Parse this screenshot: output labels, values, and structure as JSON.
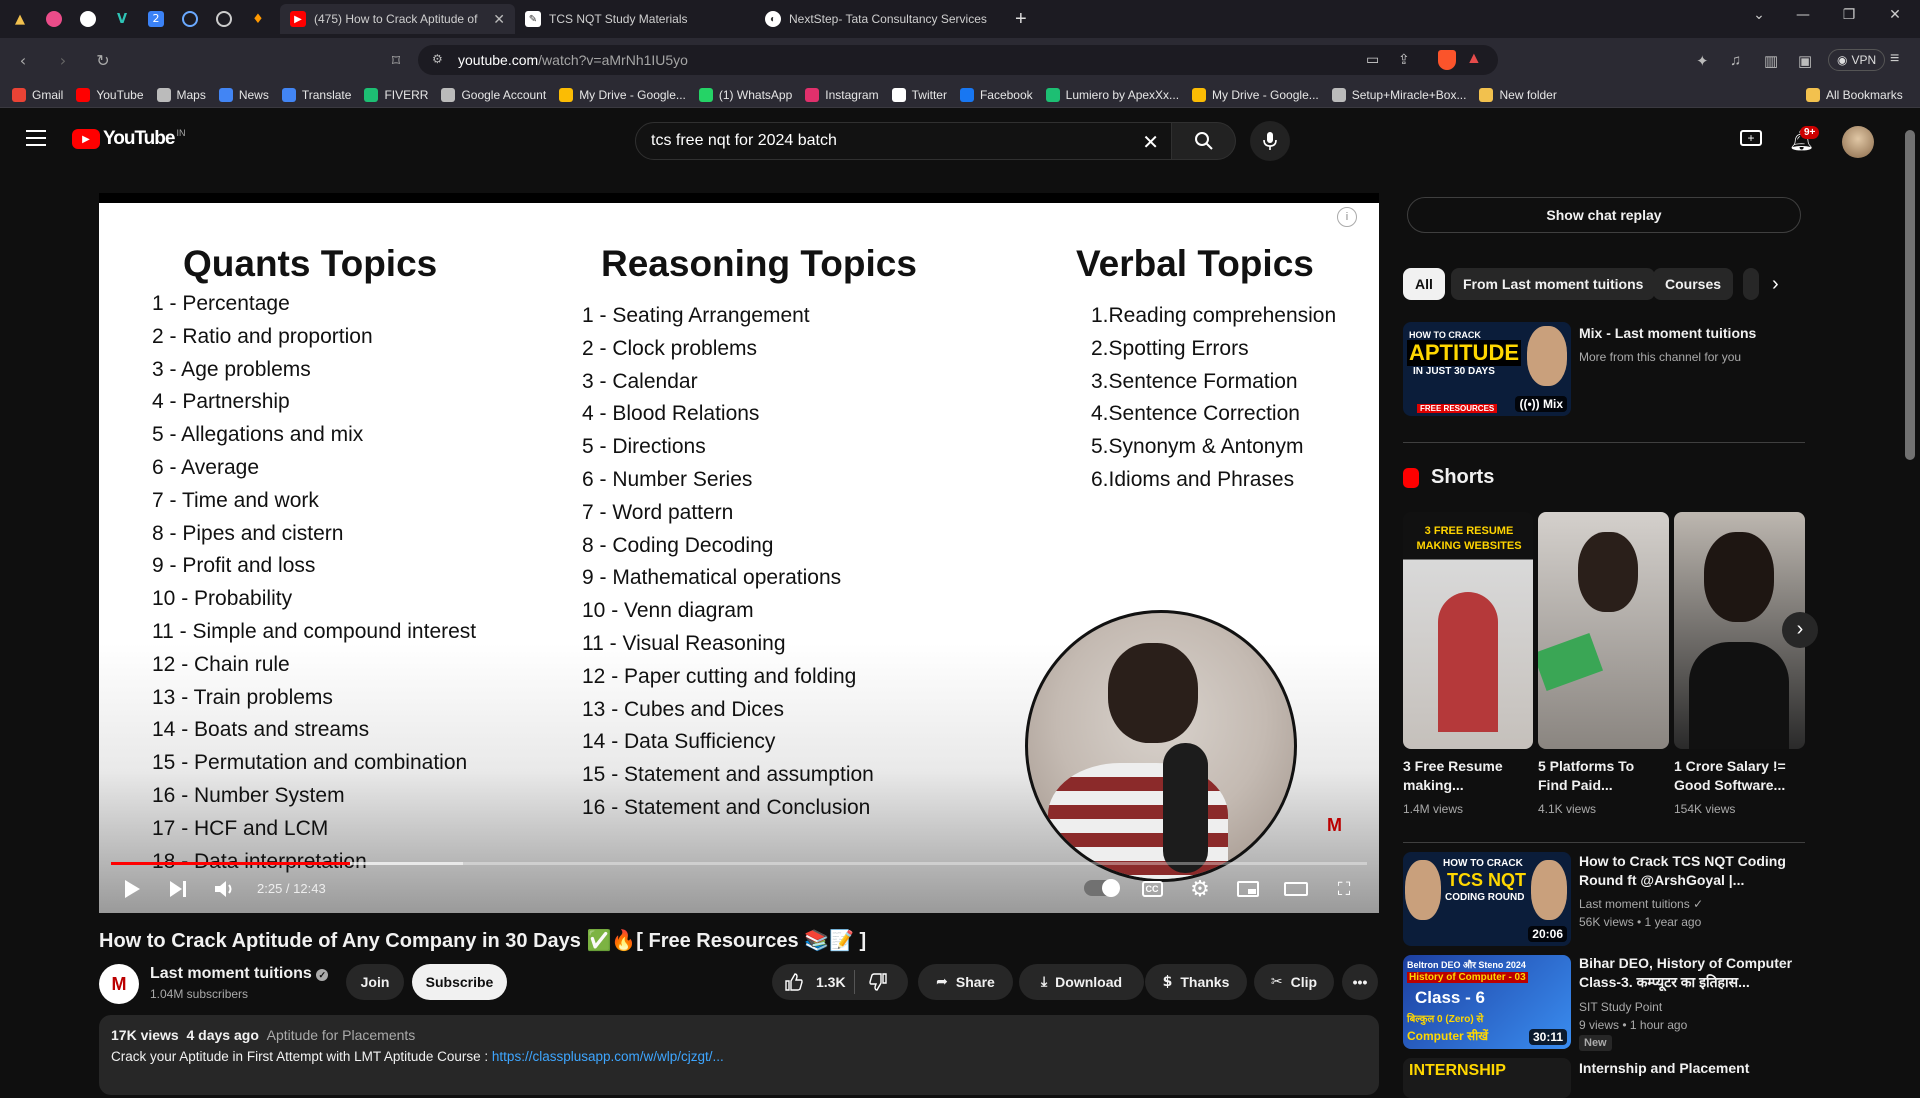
{
  "browser": {
    "tabs": [
      {
        "title": "(475) How to Crack Aptitude of",
        "active": true
      },
      {
        "title": "TCS NQT Study Materials",
        "active": false
      },
      {
        "title": "NextStep- Tata Consultancy Services",
        "active": false
      }
    ],
    "pinned_tab_icons": [
      "triangle-icon",
      "dribbble-icon",
      "github-icon",
      "vector-icon",
      "number-2-icon",
      "circle-logo-icon",
      "chrome-icon",
      "flame-icon"
    ],
    "new_tab": "+",
    "url_domain": "youtube.com",
    "url_path": "/watch?v=aMrNh1IU5yo",
    "vpn_label": "VPN",
    "bookmarks": [
      {
        "label": "Gmail",
        "color": "#ea4335"
      },
      {
        "label": "YouTube",
        "color": "#ff0000"
      },
      {
        "label": "Maps",
        "color": "#bbbbbb"
      },
      {
        "label": "News",
        "color": "#4285f4"
      },
      {
        "label": "Translate",
        "color": "#4285f4"
      },
      {
        "label": "FIVERR",
        "color": "#1dbf73"
      },
      {
        "label": "Google Account",
        "color": "#bbbbbb"
      },
      {
        "label": "My Drive - Google...",
        "color": "#fbbc04"
      },
      {
        "label": "(1) WhatsApp",
        "color": "#25d366"
      },
      {
        "label": "Instagram",
        "color": "#e1306c"
      },
      {
        "label": "Twitter",
        "color": "#ffffff"
      },
      {
        "label": "Facebook",
        "color": "#1877f2"
      },
      {
        "label": "Lumiero by ApexXx...",
        "color": "#1dbf73"
      },
      {
        "label": "My Drive - Google...",
        "color": "#fbbc04"
      },
      {
        "label": "Setup+Miracle+Box...",
        "color": "#bbbbbb"
      },
      {
        "label": "New folder",
        "color": "#f2c14e"
      }
    ],
    "all_bookmarks": "All Bookmarks"
  },
  "youtube": {
    "logo_text": "YouTube",
    "region": "IN",
    "search_value": "tcs free nqt for 2024 batch",
    "notification_count": "9+",
    "accent": "#ff0000"
  },
  "video": {
    "slide": {
      "quants_title": "Quants Topics",
      "quants": [
        "1 - Percentage",
        "2 - Ratio and proportion",
        "3 - Age problems",
        "4 - Partnership",
        "5 - Allegations and mix",
        "6 - Average",
        "7 - Time and work",
        "8 - Pipes and cistern",
        "9 - Profit and loss",
        "10 - Probability",
        "11 - Simple and compound interest",
        "12 - Chain rule",
        "13 - Train problems",
        "14 - Boats and streams",
        "15 - Permutation and combination",
        "16 - Number System",
        "17 - HCF and LCM",
        "18 - Data interpretation"
      ],
      "reasoning_title": "Reasoning Topics",
      "reasoning": [
        "1 - Seating Arrangement",
        "2 - Clock problems",
        "3 - Calendar",
        "4 - Blood Relations",
        "5 - Directions",
        "6 - Number Series",
        "7 - Word pattern",
        "8 - Coding Decoding",
        "9 - Mathematical operations",
        "10 - Venn diagram",
        "11 - Visual Reasoning",
        "12 - Paper cutting and folding",
        "13 - Cubes and Dices",
        "14 - Data Sufficiency",
        "15 - Statement and assumption",
        "16 - Statement and Conclusion"
      ],
      "verbal_title": "Verbal Topics",
      "verbal": [
        "1.Reading comprehension",
        "2.Spotting Errors",
        "3.Sentence Formation",
        "4.Sentence Correction",
        "5.Synonym & Antonym",
        "6.Idioms and Phrases"
      ]
    },
    "time": "2:25 / 12:43",
    "progress": 0.19,
    "buffered": 0.28,
    "title": "How to Crack Aptitude of Any Company in 30 Days ✅🔥[ Free Resources 📚📝 ]",
    "channel": "Last moment tuitions",
    "subscribers": "1.04M subscribers",
    "join": "Join",
    "subscribe": "Subscribe",
    "likes": "1.3K",
    "share": "Share",
    "download": "Download",
    "thanks": "Thanks",
    "clip": "Clip",
    "views": "17K views",
    "age": "4 days ago",
    "playlist": "Aptitude for Placements",
    "desc_line": "Crack your Aptitude in First Attempt with LMT  Aptitude  Course : ",
    "desc_link": "https://classplusapp.com/w/wlp/cjzgt/..."
  },
  "sidebar": {
    "chat_replay": "Show chat replay",
    "chips": [
      "All",
      "From Last moment tuitions",
      "Courses"
    ],
    "mix": {
      "title": "Mix - Last moment tuitions",
      "sub": "More from this channel for you",
      "badge": "Mix",
      "thumb_lines": [
        "HOW TO CRACK",
        "APTITUDE",
        "IN JUST 30 DAYS",
        "FREE RESOURCES"
      ]
    },
    "shorts_heading": "Shorts",
    "shorts": [
      {
        "title": "3 Free Resume making...",
        "views": "1.4M views",
        "overlay": "3 FREE RESUME MAKING WEBSITES"
      },
      {
        "title": "5 Platforms To Find Paid...",
        "views": "4.1K views",
        "overlay": ""
      },
      {
        "title": "1 Crore Salary != Good Software...",
        "views": "154K views",
        "overlay": ""
      }
    ],
    "videos": [
      {
        "title": "How to Crack TCS NQT Coding Round ft @ArshGoyal |...",
        "channel": "Last moment tuitions",
        "meta": "56K views • 1 year ago",
        "duration": "20:06",
        "thumb_lines": [
          "HOW TO CRACK",
          "TCS NQT",
          "CODING ROUND"
        ]
      },
      {
        "title": "Bihar DEO, History of Computer Class-3. कम्प्यूटर का इतिहास...",
        "channel": "SIT Study Point",
        "meta": "9 views • 1 hour ago",
        "duration": "30:11",
        "badge": "New",
        "thumb_lines": [
          "Beltron DEO और Steno 2024",
          "History of Computer - 03",
          "Class - 6",
          "बिल्कुल 0 (Zero) से",
          "Computer सीखें"
        ]
      },
      {
        "title": "Internship and Placement",
        "thumb_lines": [
          "INTERNSHIP"
        ]
      }
    ]
  }
}
